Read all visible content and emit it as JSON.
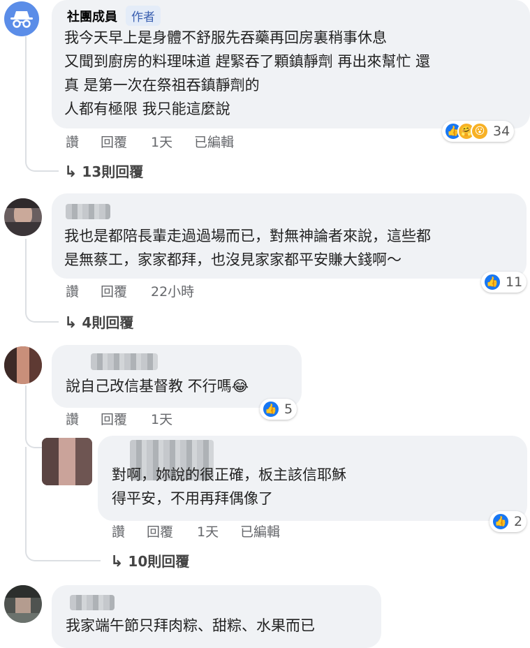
{
  "comments": [
    {
      "author": "社團成員",
      "badge": "作者",
      "text": "我今天早上是身體不舒服先吞藥再回房裏稍事休息\n又聞到廚房的料理味道 趕緊吞了顆鎮靜劑 再出來幫忙 還\n真 是第一次在祭祖吞鎮靜劑的\n人都有極限 我只能這麼說",
      "actions": {
        "like": "讚",
        "reply": "回覆",
        "time": "1天",
        "edited": "已編輯"
      },
      "reactions": {
        "icons": [
          "like-icon",
          "care-icon",
          "wow-icon"
        ],
        "count": "34"
      },
      "replies_label": "13則回覆"
    },
    {
      "author": "",
      "text": "我也是都陪長輩走過過場而已，對無神論者來說，這些都\n是無蔡工，家家都拜，也沒見家家都平安賺大錢啊～",
      "actions": {
        "like": "讚",
        "reply": "回覆",
        "time": "22小時"
      },
      "reactions": {
        "icons": [
          "like-icon"
        ],
        "count": "11"
      },
      "replies_label": "4則回覆"
    },
    {
      "author": "",
      "text": "說自己改信基督教 不行嗎😂",
      "actions": {
        "like": "讚",
        "reply": "回覆",
        "time": "1天"
      },
      "reactions": {
        "icons": [
          "like-icon"
        ],
        "count": "5"
      },
      "reply": {
        "author": "",
        "text": "對啊，妳說的很正確，板主該信耶穌\n得平安，不用再拜偶像了",
        "actions": {
          "like": "讚",
          "reply": "回覆",
          "time": "1天",
          "edited": "已編輯"
        },
        "reactions": {
          "icons": [
            "like-icon"
          ],
          "count": "2"
        }
      },
      "replies_label": "10則回覆"
    },
    {
      "author": "",
      "text": "我家端午節只拜肉粽、甜粽、水果而已"
    }
  ],
  "colors": {
    "bubble": "#f0f2f5",
    "like": "#1877f2",
    "meta": "#65676b",
    "thread": "#dcdfe3"
  }
}
